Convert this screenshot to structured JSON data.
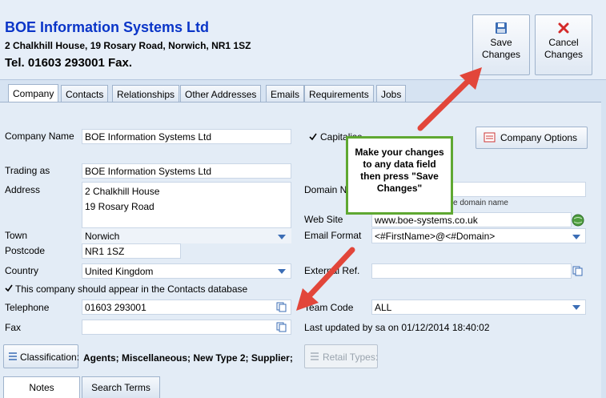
{
  "header": {
    "company_name": "BOE Information Systems Ltd",
    "address_line": "2 Chalkhill House, 19 Rosary Road, Norwich, NR1 1SZ",
    "tel_line": "Tel. 01603 293001  Fax.",
    "save_label": "Save\nChanges",
    "cancel_label": "Cancel\nChanges"
  },
  "tabs": [
    "Company",
    "Contacts",
    "Relationships",
    "Other Addresses",
    "Emails",
    "Requirements",
    "Jobs"
  ],
  "form": {
    "company_name_label": "Company Name",
    "company_name_value": "BOE Information Systems Ltd",
    "capitalise_label": "Capitalise",
    "trading_as_label": "Trading as",
    "trading_as_value": "BOE Information Systems Ltd",
    "address_label": "Address",
    "address_line1": "2 Chalkhill House",
    "address_line2": "19 Rosary Road",
    "town_label": "Town",
    "town_value": "Norwich",
    "postcode_label": "Postcode",
    "postcode_value": "NR1 1SZ",
    "country_label": "Country",
    "country_value": "United Kingdom",
    "contacts_db_label": "This company should appear in the Contacts database",
    "telephone_label": "Telephone",
    "telephone_value": "01603 293001",
    "fax_label": "Fax",
    "fax_value": "",
    "domain_label": "Domain N",
    "domain_hint": "e domain name",
    "website_label": "Web Site",
    "website_value": "www.boe-systems.co.uk",
    "email_format_label": "Email Format",
    "email_format_value": "<#FirstName>@<#Domain>",
    "external_ref_label": "External Ref.",
    "external_ref_value": "",
    "team_code_label": "Team Code",
    "team_code_value": "ALL",
    "last_updated": "Last updated by sa on 01/12/2014 18:40:02",
    "company_options_label": "Company Options",
    "classification_label": "Classification:",
    "classification_value": "Agents; Miscellaneous; New Type 2; Supplier;",
    "retail_types_label": "Retail Types:"
  },
  "callout": {
    "text": "Make your changes to any data field then press \"Save Changes\""
  },
  "bottom_tabs": [
    "Notes",
    "Search Terms"
  ],
  "colors": {
    "title_blue": "#0a35c8",
    "arrow_red": "#e2463a",
    "callout_border": "#5fa832"
  }
}
